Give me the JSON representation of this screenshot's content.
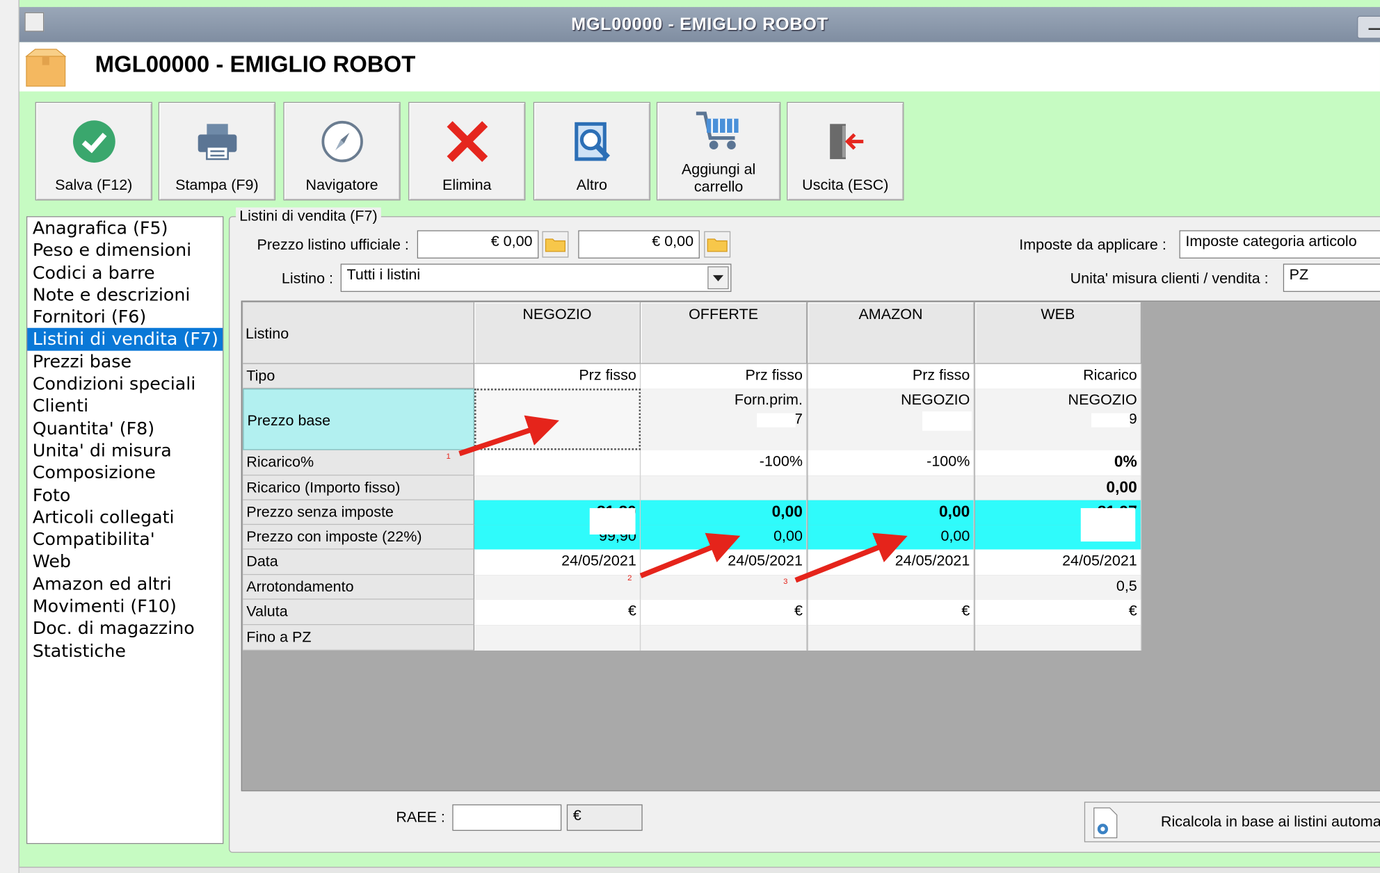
{
  "window": {
    "title": "MGL00000 - EMIGLIO ROBOT"
  },
  "header": {
    "title": "MGL00000 - EMIGLIO ROBOT"
  },
  "toolbar": {
    "salva": "Salva (F12)",
    "stampa": "Stampa (F9)",
    "navigatore": "Navigatore",
    "elimina": "Elimina",
    "altro": "Altro",
    "carrello_1": "Aggiungi al",
    "carrello_2": "carrello",
    "uscita": "Uscita (ESC)"
  },
  "nav": {
    "items": [
      "Anagrafica (F5)",
      "Peso e dimensioni",
      "Codici a barre",
      "Note e descrizioni",
      "Fornitori (F6)",
      "Listini di vendita (F7)",
      "Prezzi base",
      "Condizioni speciali",
      "Clienti",
      "Quantita' (F8)",
      "Unita' di misura",
      "Composizione",
      "Foto",
      "Articoli collegati",
      "Compatibilita'",
      "Web",
      "Amazon ed altri",
      "Movimenti (F10)",
      "Doc. di magazzino",
      "Statistiche"
    ],
    "selected_index": 5
  },
  "form": {
    "group_title": "Listini di vendita (F7)",
    "prezzo_label": "Prezzo listino ufficiale :",
    "prezzo_1": "€ 0,00",
    "prezzo_2": "€ 0,00",
    "listino_label": "Listino :",
    "listino_value": "Tutti i listini",
    "imposte_label": "Imposte da applicare :",
    "imposte_value": "Imposte categoria articolo",
    "unita_label": "Unita' misura clienti / vendita :",
    "unita_value": "PZ"
  },
  "grid": {
    "corner": "Listino",
    "columns": [
      "NEGOZIO",
      "OFFERTE",
      "AMAZON",
      "WEB"
    ],
    "rows": {
      "tipo": {
        "label": "Tipo",
        "values": [
          "Prz fisso",
          "Prz fisso",
          "Prz fisso",
          "Ricarico"
        ]
      },
      "prezzo_base": {
        "label": "Prezzo base",
        "line1": [
          "",
          "Forn.prim.",
          "NEGOZIO",
          "NEGOZIO"
        ],
        "line2": [
          "",
          "7",
          "",
          "9"
        ]
      },
      "ricarico_pct": {
        "label": "Ricarico%",
        "values": [
          "",
          "-100%",
          "-100%",
          "0%"
        ]
      },
      "ricarico_fisso": {
        "label": "Ricarico (Importo fisso)",
        "values": [
          "",
          "",
          "",
          "0,00"
        ]
      },
      "prezzo_senza": {
        "label": "Prezzo senza imposte",
        "values": [
          "81,80",
          "0,00",
          "0,00",
          "81,97"
        ]
      },
      "prezzo_con": {
        "label": "Prezzo con imposte (22%)",
        "values": [
          "99,90",
          "0,00",
          "0,00",
          ""
        ]
      },
      "data": {
        "label": "Data",
        "values": [
          "24/05/2021",
          "24/05/2021",
          "24/05/2021",
          "24/05/2021"
        ]
      },
      "arrotondamento": {
        "label": "Arrotondamento",
        "values": [
          "",
          "",
          "",
          "0,5"
        ]
      },
      "valuta": {
        "label": "Valuta",
        "values": [
          "€",
          "€",
          "€",
          "€"
        ]
      },
      "fino": {
        "label": "Fino a PZ",
        "values": [
          "",
          "",
          "",
          ""
        ]
      }
    }
  },
  "annotations": {
    "a1": "1",
    "a2": "2",
    "a3": "3"
  },
  "footer": {
    "raee_label": "RAEE :",
    "raee_value": "",
    "raee_currency": "€",
    "ricalcola": "Ricalcola in base ai listini automat"
  },
  "colors": {
    "background": "#c6fbc2",
    "selected": "#0a78d7",
    "cyan": "#2ffbfb",
    "rowhdr_highlight": "#b2f0f0",
    "arrow": "#e5241b"
  }
}
